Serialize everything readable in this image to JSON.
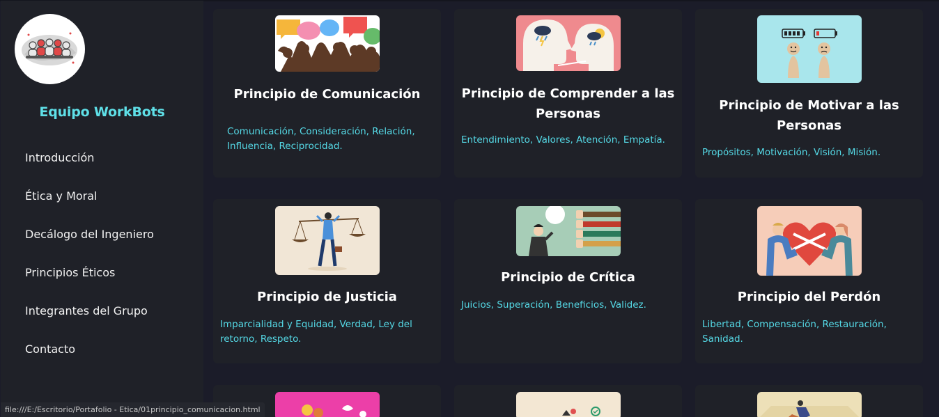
{
  "sidebar": {
    "brand": "Equipo WorkBots",
    "nav": [
      "Introducción",
      "Ética y Moral",
      "Decálogo del Ingeniero",
      "Principios Éticos",
      "Integrantes del Grupo",
      "Contacto"
    ]
  },
  "cards": [
    {
      "title": "Principio de Comunicación",
      "desc": "Comunicación, Consideración, Relación, Influencia, Reciprocidad."
    },
    {
      "title": "Principio de Comprender a las Personas",
      "desc": "Entendimiento, Valores, Atención, Empatía."
    },
    {
      "title": "Principio de Motivar a las Personas",
      "desc": "Propósitos, Motivación, Visión, Misión."
    },
    {
      "title": "Principio de Justicia",
      "desc": "Imparcialidad y Equidad, Verdad, Ley del retorno, Respeto."
    },
    {
      "title": "Principio de Crítica",
      "desc": "Juicios, Superación, Beneficios, Validez."
    },
    {
      "title": "Principio del Perdón",
      "desc": "Libertad, Compensación, Restauración, Sanidad."
    }
  ],
  "status": "file:///E:/Escritorio/Portafolio - Etica/01principio_comunicacion.html",
  "colors": {
    "background": "#1b1c29",
    "panel": "#1f2128",
    "accent": "#5fe0e8",
    "description": "#55d9e6"
  }
}
